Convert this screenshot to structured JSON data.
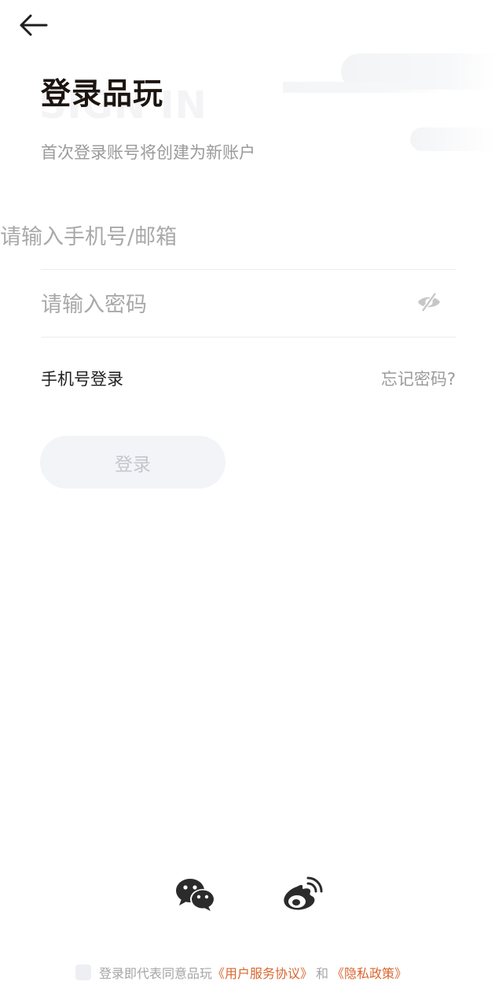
{
  "header": {
    "back_icon": "arrow-left-icon"
  },
  "title": {
    "watermark": "SIGN IN",
    "heading": "登录品玩",
    "subtitle": "首次登录账号将创建为新账户"
  },
  "form": {
    "account_placeholder": "请输入手机号/邮箱",
    "password_placeholder": "请输入密码",
    "password_toggle_icon": "eye-off-icon",
    "phone_login_label": "手机号登录",
    "forgot_password_label": "忘记密码?",
    "login_button_label": "登录"
  },
  "social": {
    "wechat_icon": "wechat-icon",
    "weibo_icon": "weibo-icon"
  },
  "agreement": {
    "prefix": "登录即代表同意品玩",
    "terms_link": "《用户服务协议》",
    "and": "和",
    "privacy_link": "《隐私政策》"
  },
  "colors": {
    "accent_link": "#d8662f",
    "title": "#1c1410",
    "button_bg_disabled": "#f3f4f7",
    "button_text_disabled": "#c4c6cc"
  }
}
